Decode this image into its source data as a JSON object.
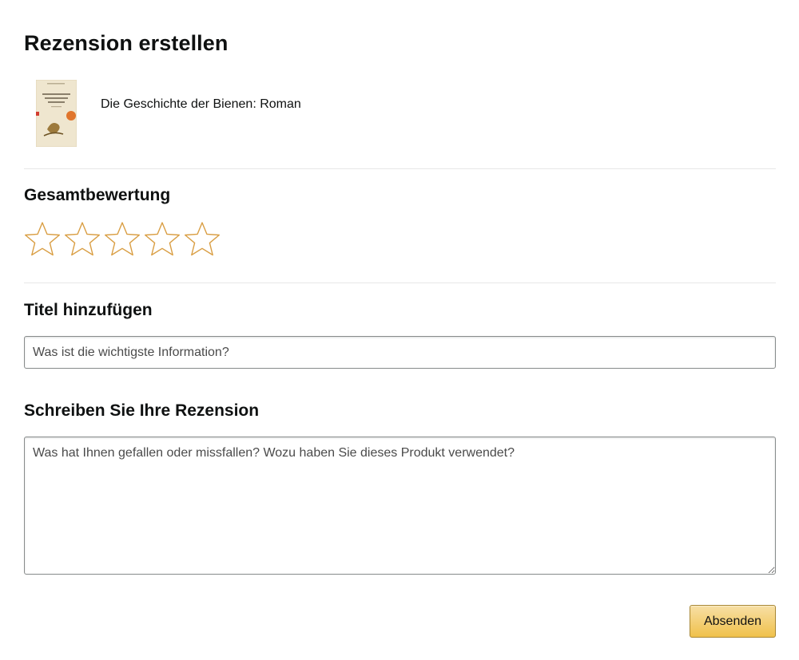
{
  "page": {
    "title": "Rezension erstellen"
  },
  "product": {
    "name": "Die Geschichte der Bienen: Roman"
  },
  "rating": {
    "heading": "Gesamtbewertung",
    "max_stars": 5,
    "selected_stars": 0,
    "star_outline_color": "#d99e43"
  },
  "title_field": {
    "heading": "Titel hinzufügen",
    "value": "",
    "placeholder": "Was ist die wichtigste Information?"
  },
  "review_field": {
    "heading": "Schreiben Sie Ihre Rezension",
    "value": "",
    "placeholder": "Was hat Ihnen gefallen oder missfallen? Wozu haben Sie dieses Produkt verwendet?"
  },
  "actions": {
    "submit_label": "Absenden",
    "submit_color": "#f0c14b"
  }
}
